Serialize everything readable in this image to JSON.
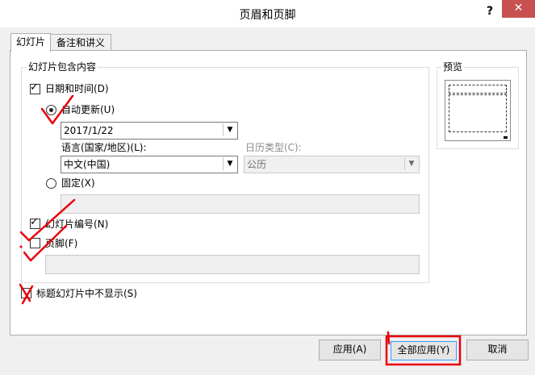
{
  "window": {
    "title": "页眉和页脚",
    "help": "?",
    "close": "✕"
  },
  "tabs": [
    {
      "label": "幻灯片",
      "active": true
    },
    {
      "label": "备注和讲义",
      "active": false
    }
  ],
  "slide_content": {
    "legend": "幻灯片包含内容",
    "datetime": {
      "label": "日期和时间(D)",
      "checked": true
    },
    "auto_update": {
      "label": "自动更新(U)",
      "selected": true,
      "date_value": "2017/1/22"
    },
    "language": {
      "label": "语言(国家/地区)(L):",
      "value": "中文(中国)"
    },
    "calendar": {
      "label": "日历类型(C):",
      "value": "公历"
    },
    "fixed": {
      "label": "固定(X)",
      "selected": false,
      "value": ""
    },
    "slide_number": {
      "label": "幻灯片编号(N)",
      "checked": true
    },
    "footer": {
      "label": "页脚(F)",
      "checked": false,
      "value": ""
    }
  },
  "dont_show_on_title": {
    "label": "标题幻灯片中不显示(S)",
    "checked": false
  },
  "preview": {
    "legend": "预览"
  },
  "buttons": {
    "apply": "应用(A)",
    "apply_all": "全部应用(Y)",
    "cancel": "取消"
  },
  "colors": {
    "close_bg": "#c75050",
    "annotation": "#e8000b"
  }
}
